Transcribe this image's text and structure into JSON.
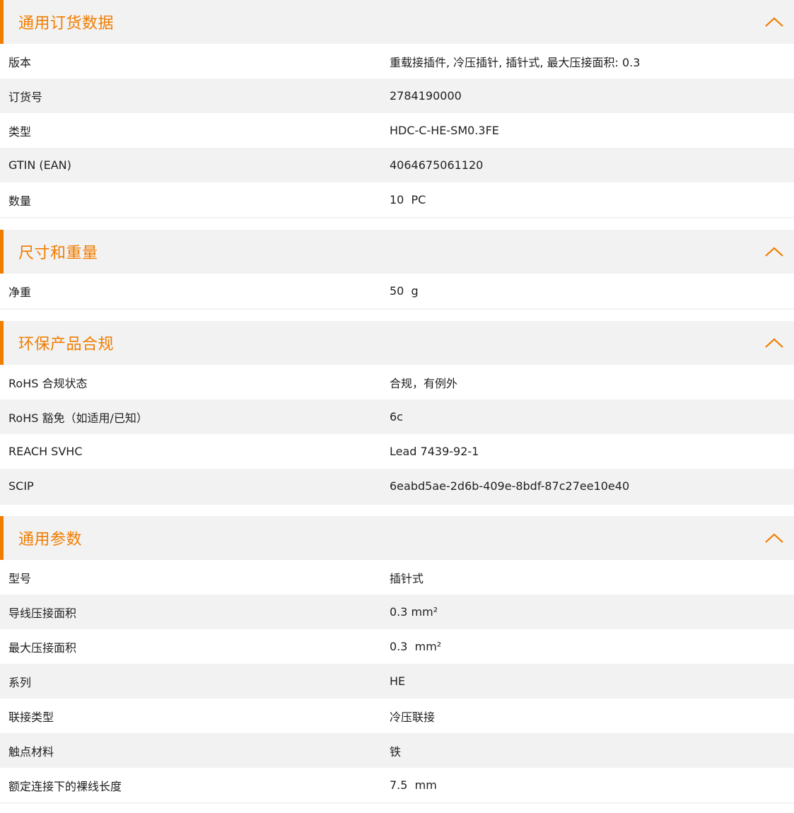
{
  "colors": {
    "accent": "#f07d00",
    "stripe": "#f2f2f2"
  },
  "icons": {
    "collapse": "chevron-up-icon"
  },
  "sections": [
    {
      "title": "通用订货数据",
      "rows": [
        {
          "label": "版本",
          "value": "重载接插件, 冷压插针, 插针式, 最大压接面积: 0.3"
        },
        {
          "label": "订货号",
          "value": "2784190000"
        },
        {
          "label": "类型",
          "value": "HDC-C-HE-SM0.3FE"
        },
        {
          "label": "GTIN (EAN)",
          "value": "4064675061120"
        },
        {
          "label": "数量",
          "value": "10  PC"
        }
      ]
    },
    {
      "title": "尺寸和重量",
      "rows": [
        {
          "label": "净重",
          "value": "50  g"
        }
      ]
    },
    {
      "title": "环保产品合规",
      "rows": [
        {
          "label": "RoHS 合规状态",
          "value": "合规，有例外"
        },
        {
          "label": "RoHS 豁免（如适用/已知）",
          "value": "6c"
        },
        {
          "label": "REACH SVHC",
          "value": "Lead 7439-92-1"
        },
        {
          "label": "SCIP",
          "value": "6eabd5ae-2d6b-409e-8bdf-87c27ee10e40"
        }
      ]
    },
    {
      "title": "通用参数",
      "rows": [
        {
          "label": "型号",
          "value": "插针式"
        },
        {
          "label": "导线压接面积",
          "value": "0.3 mm²"
        },
        {
          "label": "最大压接面积",
          "value": "0.3  mm²"
        },
        {
          "label": "系列",
          "value": "HE"
        },
        {
          "label": "联接类型",
          "value": "冷压联接"
        },
        {
          "label": "触点材料",
          "value": "铁"
        },
        {
          "label": "额定连接下的裸线长度",
          "value": "7.5  mm"
        }
      ]
    }
  ]
}
